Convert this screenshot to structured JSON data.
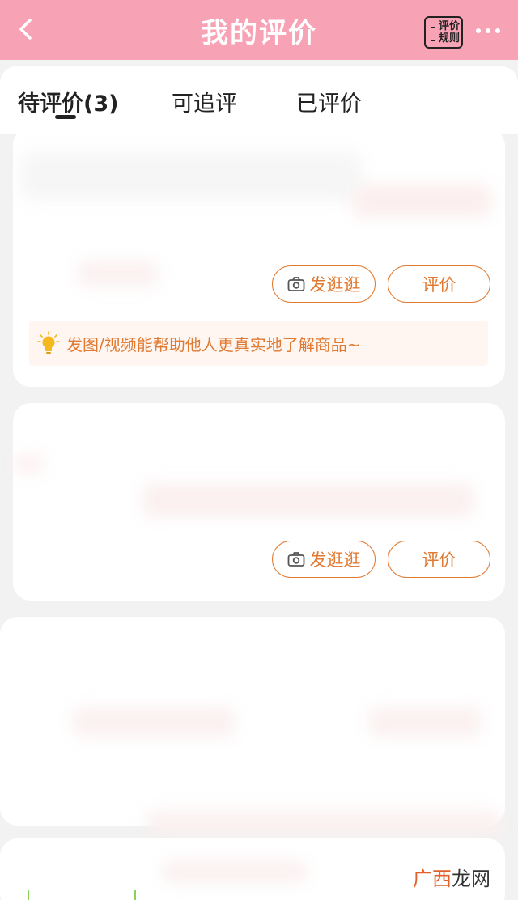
{
  "header": {
    "title": "我的评价",
    "rules_line1": "评价",
    "rules_line2": "规则",
    "background_color": "#f7a3b5"
  },
  "tabs": [
    {
      "label": "待评价(3)",
      "active": true
    },
    {
      "label": "可追评",
      "active": false
    },
    {
      "label": "已评价",
      "active": false
    }
  ],
  "orders": [
    {
      "post_label": "发逛逛",
      "review_label": "评价"
    },
    {
      "post_label": "发逛逛",
      "review_label": "评价"
    }
  ],
  "tip": {
    "text": "发图/视频能帮助他人更真实地了解商品~",
    "icon": "lightbulb-icon"
  },
  "watermark": {
    "part1": "广西",
    "part2": "龙网"
  },
  "colors": {
    "accent": "#e07a32",
    "tip_bg": "#fff5f1"
  }
}
